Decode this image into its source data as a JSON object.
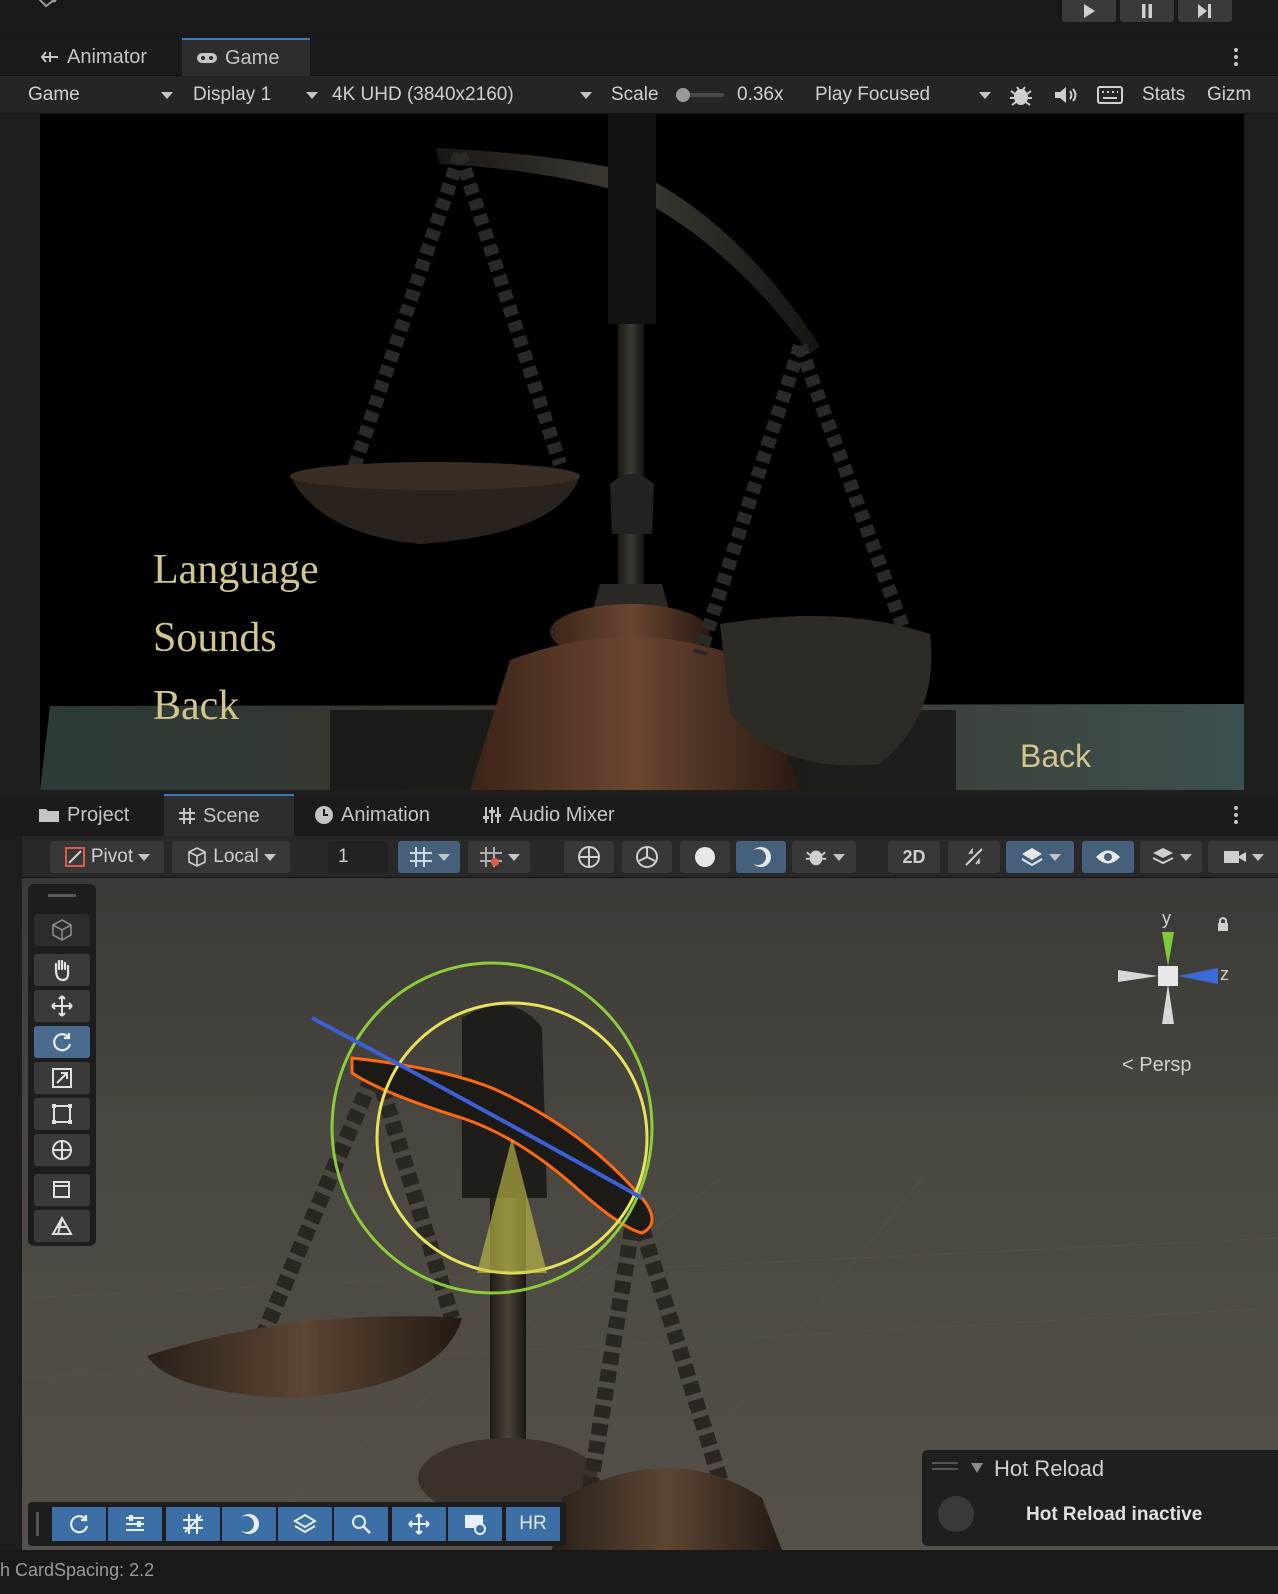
{
  "window": {
    "tabs_top": [
      {
        "label": "Animator",
        "icon": "animator-icon"
      },
      {
        "label": "Game",
        "icon": "gamepad-icon"
      }
    ]
  },
  "game_toolbar": {
    "display_mode": "Game",
    "display": "Display 1",
    "resolution": "4K UHD (3840x2160)",
    "scale_label": "Scale",
    "scale_value": "0.36x",
    "play_mode": "Play Focused",
    "stats": "Stats",
    "gizmos": "Gizm"
  },
  "game_view": {
    "menu_items": [
      "Language",
      "Sounds",
      "Back"
    ],
    "back_button": "Back"
  },
  "scene_tabs": [
    {
      "label": "Project",
      "icon": "folder-icon"
    },
    {
      "label": "Scene",
      "icon": "grid-icon"
    },
    {
      "label": "Animation",
      "icon": "clock-icon"
    },
    {
      "label": "Audio Mixer",
      "icon": "mixer-icon"
    }
  ],
  "scene_toolbar": {
    "pivot": "Pivot",
    "local": "Local",
    "grid_increment": "1",
    "mode_2d": "2D"
  },
  "scene_view": {
    "axis_y": "y",
    "axis_z": "z",
    "projection": "< Persp"
  },
  "hot_reload": {
    "title": "Hot Reload",
    "status": "Hot Reload inactive"
  },
  "overlay_bar": {
    "hr_label": "HR"
  },
  "status_bar": {
    "text": "h CardSpacing: 2.2"
  }
}
